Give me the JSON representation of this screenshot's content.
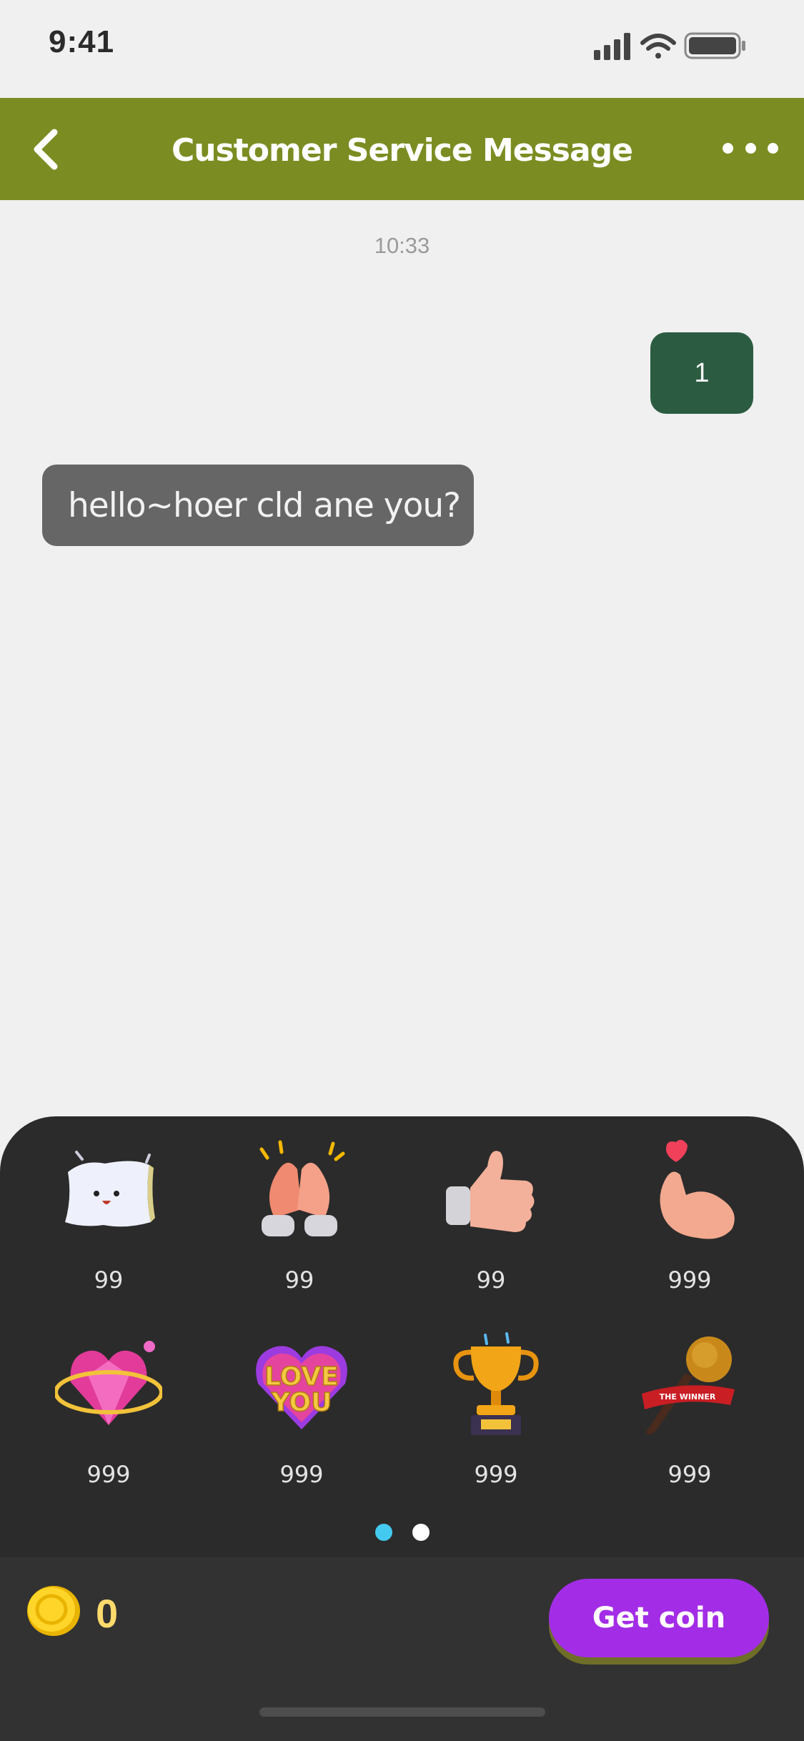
{
  "status_bar": {
    "time": "9:41"
  },
  "header": {
    "title": "Customer Service Message"
  },
  "chat": {
    "timestamp": "10:33",
    "outgoing_message": "1",
    "incoming_message": "hello~hoer cld ane you?"
  },
  "gifts": [
    {
      "name": "pillow-gift-icon",
      "price": "99"
    },
    {
      "name": "clapping-hands-gift-icon",
      "price": "99"
    },
    {
      "name": "thumbs-up-gift-icon",
      "price": "99"
    },
    {
      "name": "finger-heart-gift-icon",
      "price": "999"
    },
    {
      "name": "diamond-heart-gift-icon",
      "price": "999"
    },
    {
      "name": "love-you-heart-gift-icon",
      "price": "999"
    },
    {
      "name": "trophy-gift-icon",
      "price": "999"
    },
    {
      "name": "microphone-gift-icon",
      "price": "999"
    }
  ],
  "pagination": {
    "pages": 2,
    "active_page": 1,
    "active_color": "#44c9f0",
    "inactive_color": "#ffffff"
  },
  "wallet": {
    "coin_balance": "0",
    "get_coin_label": "Get coin"
  },
  "colors": {
    "header": "#7b8d22",
    "outgoing_bubble": "#2b5c41",
    "incoming_bubble": "#666666",
    "panel": "#2b2b2b",
    "coin_text": "#ffda6c",
    "get_coin_button": "#a32de6"
  }
}
